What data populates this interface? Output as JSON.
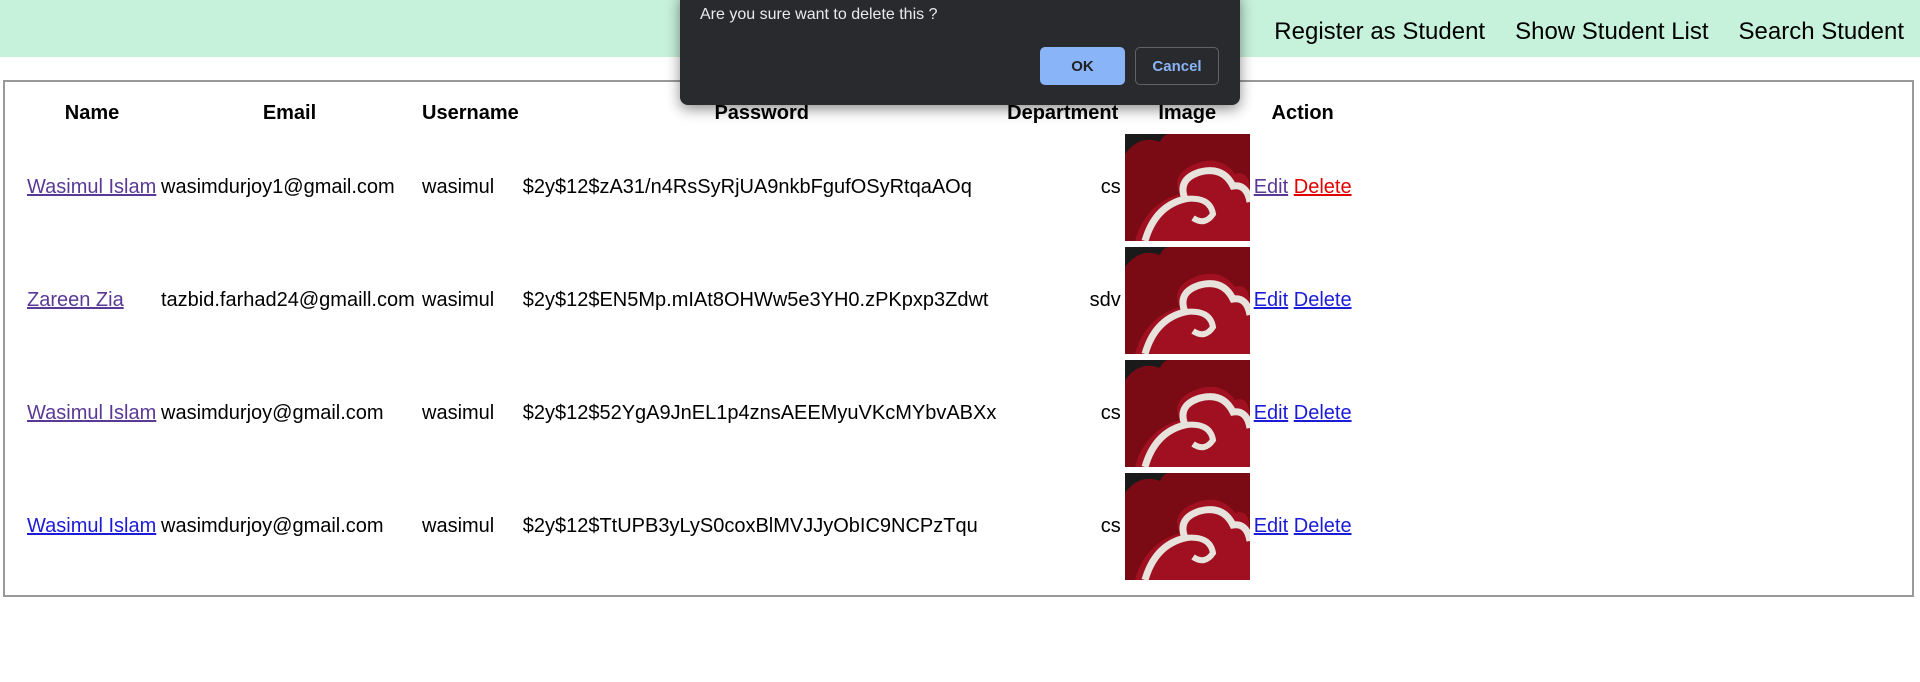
{
  "nav": {
    "register": "Register as Student",
    "show_list": "Show Student List",
    "search": "Search Student"
  },
  "table": {
    "headers": {
      "name": "Name",
      "email": "Email",
      "username": "Username",
      "password": "Password",
      "department": "Department",
      "image": "Image",
      "action": "Action"
    },
    "rows": [
      {
        "name": "Wasimul Islam",
        "email": "wasimdurjoy1@gmail.com",
        "username": "wasimul",
        "password": "$2y$12$zA31/n4RsSyRjUA9nkbFgufOSyRtqaAOq",
        "department": "cs",
        "edit": "Edit",
        "delete": "Delete"
      },
      {
        "name": "Zareen Zia",
        "email": "tazbid.farhad24@gmaill.com",
        "username": "wasimul",
        "password": "$2y$12$EN5Mp.mIAt8OHWw5e3YH0.zPKpxp3Zdwt",
        "department": "sdv",
        "edit": "Edit",
        "delete": "Delete"
      },
      {
        "name": "Wasimul Islam",
        "email": "wasimdurjoy@gmail.com",
        "username": "wasimul",
        "password": "$2y$12$52YgA9JnEL1p4znsAEEMyuVKcMYbvABXx",
        "department": "cs",
        "edit": "Edit",
        "delete": "Delete"
      },
      {
        "name": "Wasimul Islam",
        "email": "wasimdurjoy@gmail.com",
        "username": "wasimul",
        "password": "$2y$12$TtUPB3yLyS0coxBlMVJJyObIC9NCPzTqu",
        "department": "cs",
        "edit": "Edit",
        "delete": "Delete"
      }
    ]
  },
  "dialog": {
    "message": "Are you sure want to delete this ?",
    "ok": "OK",
    "cancel": "Cancel"
  }
}
